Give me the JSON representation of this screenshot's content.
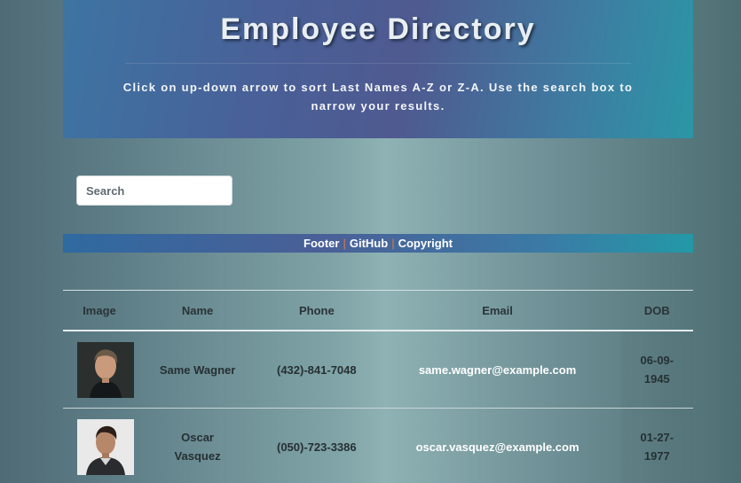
{
  "header": {
    "title": "Employee Directory",
    "subtitle": "Click on up-down arrow to sort Last Names A-Z or Z-A. Use the search box to narrow your results."
  },
  "search": {
    "placeholder": "Search",
    "value": ""
  },
  "footer": {
    "links": [
      "Footer",
      "GitHub",
      "Copyright"
    ],
    "separator": "|"
  },
  "table": {
    "columns": [
      "Image",
      "Name",
      "Phone",
      "Email",
      "DOB"
    ],
    "rows": [
      {
        "name": "Same Wagner",
        "phone": "(432)-841-7048",
        "email": "same.wagner@example.com",
        "dob": "06-09-1945"
      },
      {
        "name": "Oscar Vasquez",
        "phone": "(050)-723-3386",
        "email": "oscar.vasquez@example.com",
        "dob": "01-27-1977"
      }
    ]
  },
  "colors": {
    "header_gradient_start": "#3d74a3",
    "header_gradient_end": "#2b96a6",
    "footer_separator": "#e07a3f",
    "email_text": "#ffffff"
  }
}
